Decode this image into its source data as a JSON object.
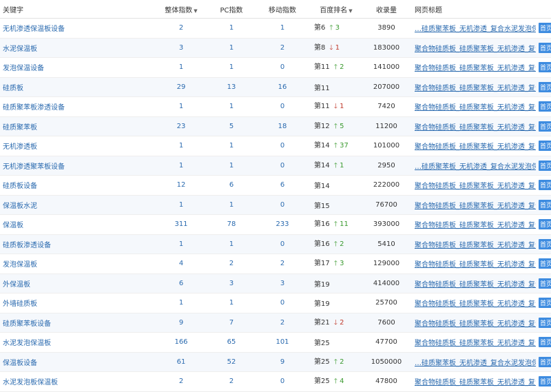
{
  "headers": {
    "keyword": "关键字",
    "overall": "整体指数",
    "pc": "PC指数",
    "mobile": "移动指数",
    "rank": "百度排名",
    "indexed": "收录量",
    "title": "网页标题"
  },
  "sort_icons": {
    "overall": "sort-down-icon",
    "rank": "sort-down-icon"
  },
  "badge_label": "首页",
  "rows": [
    {
      "keyword": "无机渗透保温板设备",
      "overall": "2",
      "pc": "1",
      "mobile": "1",
      "rank": "第6",
      "dir": "up",
      "delta": "3",
      "indexed": "3890",
      "title": "…硅质聚苯板_无机渗透_复合水泥发泡保温板_"
    },
    {
      "keyword": "水泥保温板",
      "overall": "3",
      "pc": "1",
      "mobile": "2",
      "rank": "第8",
      "dir": "down",
      "delta": "1",
      "indexed": "183000",
      "title": "聚合物硅质板_硅质聚苯板_无机渗透_复合水泥"
    },
    {
      "keyword": "发泡保温设备",
      "overall": "1",
      "pc": "1",
      "mobile": "0",
      "rank": "第11",
      "dir": "up",
      "delta": "2",
      "indexed": "141000",
      "title": "聚合物硅质板_硅质聚苯板_无机渗透_复合水泥"
    },
    {
      "keyword": "硅质板",
      "overall": "29",
      "pc": "13",
      "mobile": "16",
      "rank": "第11",
      "dir": "",
      "delta": "",
      "indexed": "207000",
      "title": "聚合物硅质板_硅质聚苯板_无机渗透_复合水泥"
    },
    {
      "keyword": "硅质聚苯板渗透设备",
      "overall": "1",
      "pc": "1",
      "mobile": "0",
      "rank": "第11",
      "dir": "down",
      "delta": "1",
      "indexed": "7420",
      "title": "聚合物硅质板_硅质聚苯板_无机渗透_复合水泥"
    },
    {
      "keyword": "硅质聚苯板",
      "overall": "23",
      "pc": "5",
      "mobile": "18",
      "rank": "第12",
      "dir": "up",
      "delta": "5",
      "indexed": "11200",
      "title": "聚合物硅质板_硅质聚苯板_无机渗透_复合水泥"
    },
    {
      "keyword": "无机渗透板",
      "overall": "1",
      "pc": "1",
      "mobile": "0",
      "rank": "第14",
      "dir": "up",
      "delta": "37",
      "indexed": "101000",
      "title": "聚合物硅质板_硅质聚苯板_无机渗透_复合水泥"
    },
    {
      "keyword": "无机渗透聚苯板设备",
      "overall": "1",
      "pc": "1",
      "mobile": "0",
      "rank": "第14",
      "dir": "up",
      "delta": "1",
      "indexed": "2950",
      "title": "…硅质聚苯板_无机渗透_复合水泥发泡保温板_"
    },
    {
      "keyword": "硅质板设备",
      "overall": "12",
      "pc": "6",
      "mobile": "6",
      "rank": "第14",
      "dir": "",
      "delta": "",
      "indexed": "222000",
      "title": "聚合物硅质板_硅质聚苯板_无机渗透_复合水泥"
    },
    {
      "keyword": "保温板水泥",
      "overall": "1",
      "pc": "1",
      "mobile": "0",
      "rank": "第15",
      "dir": "",
      "delta": "",
      "indexed": "76700",
      "title": "聚合物硅质板_硅质聚苯板_无机渗透_复合水泥"
    },
    {
      "keyword": "保温板",
      "overall": "311",
      "pc": "78",
      "mobile": "233",
      "rank": "第16",
      "dir": "up",
      "delta": "11",
      "indexed": "393000",
      "title": "聚合物硅质板_硅质聚苯板_无机渗透_复合水泥"
    },
    {
      "keyword": "硅质板渗透设备",
      "overall": "1",
      "pc": "1",
      "mobile": "0",
      "rank": "第16",
      "dir": "up",
      "delta": "2",
      "indexed": "5410",
      "title": "聚合物硅质板_硅质聚苯板_无机渗透_复合水泥"
    },
    {
      "keyword": "发泡保温板",
      "overall": "4",
      "pc": "2",
      "mobile": "2",
      "rank": "第17",
      "dir": "up",
      "delta": "3",
      "indexed": "129000",
      "title": "聚合物硅质板_硅质聚苯板_无机渗透_复合水泥"
    },
    {
      "keyword": "外保温板",
      "overall": "6",
      "pc": "3",
      "mobile": "3",
      "rank": "第19",
      "dir": "",
      "delta": "",
      "indexed": "414000",
      "title": "聚合物硅质板_硅质聚苯板_无机渗透_复合水泥"
    },
    {
      "keyword": "外墙硅质板",
      "overall": "1",
      "pc": "1",
      "mobile": "0",
      "rank": "第19",
      "dir": "",
      "delta": "",
      "indexed": "25700",
      "title": "聚合物硅质板_硅质聚苯板_无机渗透_复合水泥"
    },
    {
      "keyword": "硅质聚苯板设备",
      "overall": "9",
      "pc": "7",
      "mobile": "2",
      "rank": "第21",
      "dir": "down",
      "delta": "2",
      "indexed": "7600",
      "title": "聚合物硅质板_硅质聚苯板_无机渗透_复合水泥"
    },
    {
      "keyword": "水泥发泡保温板",
      "overall": "166",
      "pc": "65",
      "mobile": "101",
      "rank": "第25",
      "dir": "",
      "delta": "",
      "indexed": "47700",
      "title": "聚合物硅质板_硅质聚苯板_无机渗透_复合水泥"
    },
    {
      "keyword": "保温板设备",
      "overall": "61",
      "pc": "52",
      "mobile": "9",
      "rank": "第25",
      "dir": "up",
      "delta": "2",
      "indexed": "1050000",
      "title": "…硅质聚苯板_无机渗透_复合水泥发泡保温板_"
    },
    {
      "keyword": "水泥发泡板保温板",
      "overall": "2",
      "pc": "2",
      "mobile": "0",
      "rank": "第25",
      "dir": "up",
      "delta": "4",
      "indexed": "47800",
      "title": "聚合物硅质板_硅质聚苯板_无机渗透_复合水泥"
    }
  ]
}
